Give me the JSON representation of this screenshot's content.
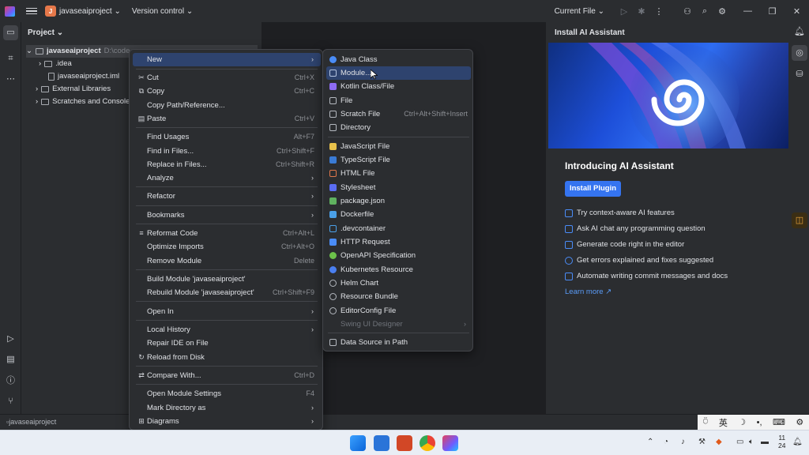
{
  "titlebar": {
    "project_badge": "J",
    "project_name": "javaseaiproject",
    "version_control": "Version control",
    "current_file": "Current File"
  },
  "project_panel": {
    "title": "Project",
    "tree": [
      {
        "label": "javaseaiproject",
        "path": "D:\\code"
      },
      {
        "label": ".idea"
      },
      {
        "label": "javaseaiproject.iml"
      },
      {
        "label": "External Libraries"
      },
      {
        "label": "Scratches and Consoles"
      }
    ]
  },
  "context_menu": {
    "items": [
      {
        "label": "New",
        "has_submenu": true
      },
      {
        "label": "Cut",
        "shortcut": "Ctrl+X"
      },
      {
        "label": "Copy",
        "shortcut": "Ctrl+C"
      },
      {
        "label": "Copy Path/Reference..."
      },
      {
        "label": "Paste",
        "shortcut": "Ctrl+V"
      },
      {
        "label": "Find Usages",
        "shortcut": "Alt+F7"
      },
      {
        "label": "Find in Files...",
        "shortcut": "Ctrl+Shift+F"
      },
      {
        "label": "Replace in Files...",
        "shortcut": "Ctrl+Shift+R"
      },
      {
        "label": "Analyze",
        "has_submenu": true
      },
      {
        "label": "Refactor",
        "has_submenu": true
      },
      {
        "label": "Bookmarks",
        "has_submenu": true
      },
      {
        "label": "Reformat Code",
        "shortcut": "Ctrl+Alt+L"
      },
      {
        "label": "Optimize Imports",
        "shortcut": "Ctrl+Alt+O"
      },
      {
        "label": "Remove Module",
        "shortcut": "Delete"
      },
      {
        "label": "Build Module 'javaseaiproject'"
      },
      {
        "label": "Rebuild Module 'javaseaiproject'",
        "shortcut": "Ctrl+Shift+F9"
      },
      {
        "label": "Open In",
        "has_submenu": true
      },
      {
        "label": "Local History",
        "has_submenu": true
      },
      {
        "label": "Repair IDE on File"
      },
      {
        "label": "Reload from Disk"
      },
      {
        "label": "Compare With...",
        "shortcut": "Ctrl+D"
      },
      {
        "label": "Open Module Settings",
        "shortcut": "F4"
      },
      {
        "label": "Mark Directory as",
        "has_submenu": true
      },
      {
        "label": "Diagrams",
        "has_submenu": true
      }
    ]
  },
  "new_submenu": {
    "items": [
      {
        "label": "Java Class",
        "color": "#4a8cf7"
      },
      {
        "label": "Module...",
        "color": "#8aa3c7"
      },
      {
        "label": "Kotlin Class/File",
        "color": "#8e6bf2"
      },
      {
        "label": "File",
        "color": "#b4b8bf"
      },
      {
        "label": "Scratch File",
        "shortcut": "Ctrl+Alt+Shift+Insert",
        "color": "#b4b8bf"
      },
      {
        "label": "Directory",
        "color": "#b4b8bf"
      },
      {
        "label": "JavaScript File",
        "color": "#e8c14b"
      },
      {
        "label": "TypeScript File",
        "color": "#3a7bd5"
      },
      {
        "label": "HTML File",
        "color": "#e0774a"
      },
      {
        "label": "Stylesheet",
        "color": "#5a6cf2"
      },
      {
        "label": "package.json",
        "color": "#5fb15f"
      },
      {
        "label": "Dockerfile",
        "color": "#4aa0e8"
      },
      {
        "label": ".devcontainer",
        "color": "#4aa0e8"
      },
      {
        "label": "HTTP Request",
        "color": "#4a8cf7"
      },
      {
        "label": "OpenAPI Specification",
        "color": "#6cc24a"
      },
      {
        "label": "Kubernetes Resource",
        "color": "#4a7ff0"
      },
      {
        "label": "Helm Chart",
        "color": "#b4b8bf"
      },
      {
        "label": "Resource Bundle",
        "color": "#b4b8bf"
      },
      {
        "label": "EditorConfig File",
        "color": "#b4b8bf"
      },
      {
        "label": "Swing UI Designer",
        "disabled": true,
        "color": "#6f737a"
      },
      {
        "label": "Data Source in Path",
        "color": "#b4b8bf"
      }
    ]
  },
  "ai_panel": {
    "title": "Install AI Assistant",
    "heading": "Introducing AI Assistant",
    "install_button": "Install Plugin",
    "features": [
      "Try context-aware AI features",
      "Ask AI chat any programming question",
      "Generate code right in the editor",
      "Get errors explained and fixes suggested",
      "Automate writing commit messages and docs"
    ],
    "learn_more": "Learn more ↗"
  },
  "statusbar": {
    "breadcrumb": "javaseaiproject"
  },
  "ime": {
    "lang": "英"
  },
  "taskbar": {
    "clock_line1": "11",
    "clock_line2": "24"
  },
  "colors": {
    "accent": "#3574f0",
    "selection": "#2e436e",
    "menu_bg": "#2b2d30"
  }
}
